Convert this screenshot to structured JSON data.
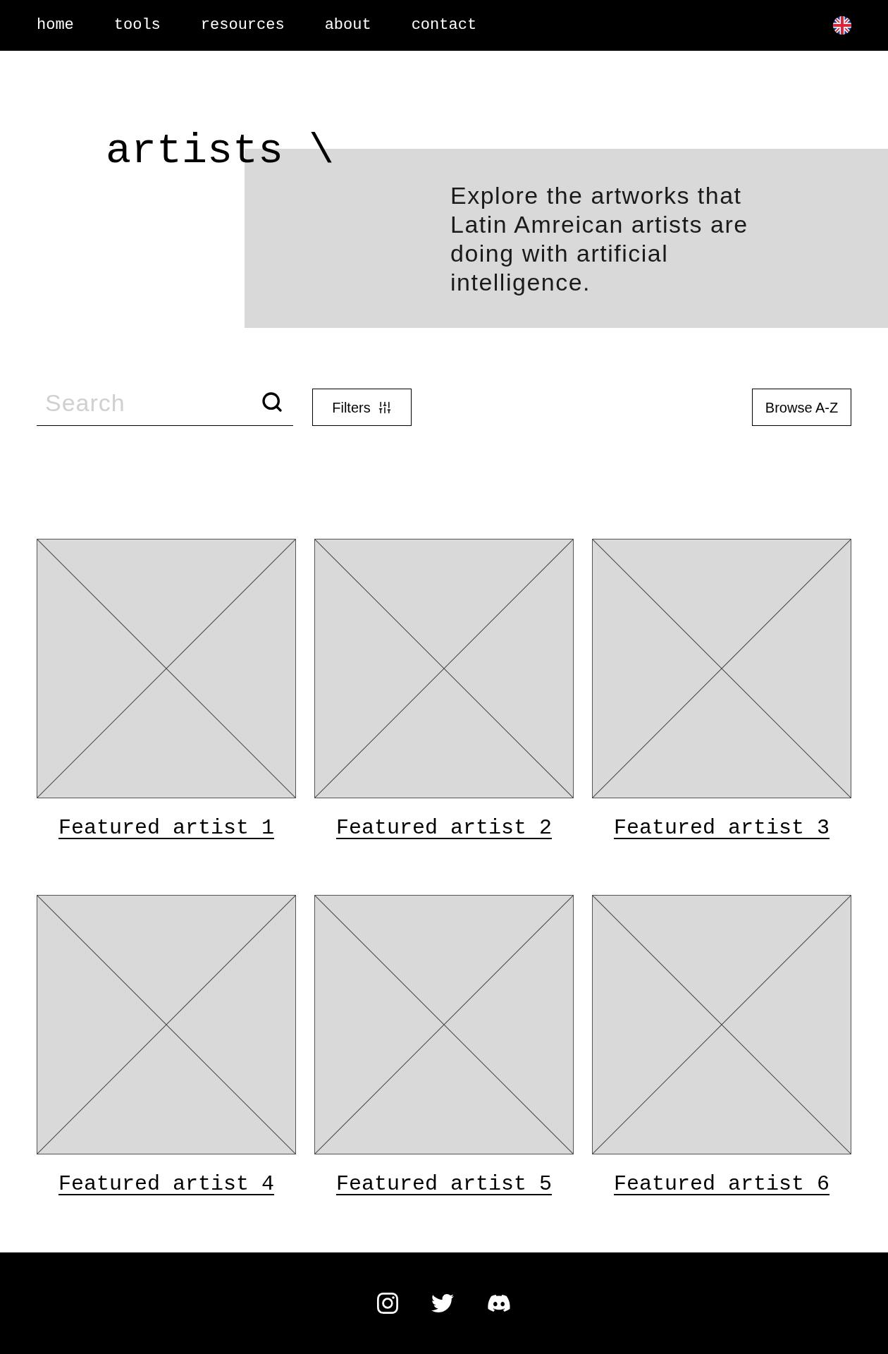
{
  "nav": {
    "links": [
      {
        "label": "home"
      },
      {
        "label": "tools"
      },
      {
        "label": "resources"
      },
      {
        "label": "about"
      },
      {
        "label": "contact"
      }
    ]
  },
  "hero": {
    "title": "artists \\",
    "description": "Explore the artworks that Latin Amreican artists are doing with artificial intelligence."
  },
  "toolbar": {
    "search": {
      "placeholder": "Search"
    },
    "filters_button": "Filters",
    "browse_button": "Browse A-Z"
  },
  "artists": [
    {
      "name": "Featured artist 1"
    },
    {
      "name": "Featured artist 2"
    },
    {
      "name": "Featured artist 3"
    },
    {
      "name": "Featured artist 4"
    },
    {
      "name": "Featured artist 5"
    },
    {
      "name": "Featured artist 6"
    }
  ]
}
